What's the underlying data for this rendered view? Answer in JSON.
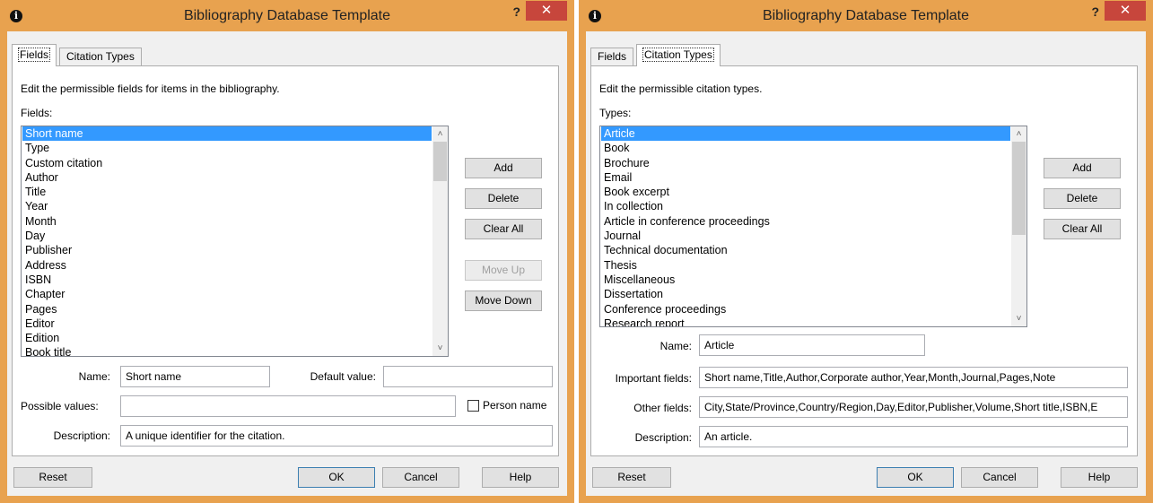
{
  "left": {
    "title": "Bibliography Database Template",
    "help_glyph": "?",
    "close_glyph": "✕",
    "tabs": [
      {
        "label": "Fields",
        "active": true
      },
      {
        "label": "Citation Types",
        "active": false
      }
    ],
    "description": "Edit the permissible fields for items in the bibliography.",
    "list_label": "Fields:",
    "list_items": [
      "Short name",
      "Type",
      "Custom citation",
      "Author",
      "Title",
      "Year",
      "Month",
      "Day",
      "Publisher",
      "Address",
      "ISBN",
      "Chapter",
      "Pages",
      "Editor",
      "Edition",
      "Book title"
    ],
    "selected_index": 0,
    "buttons": {
      "add": "Add",
      "delete": "Delete",
      "clear_all": "Clear All",
      "move_up": "Move Up",
      "move_down": "Move Down"
    },
    "name_label": "Name:",
    "name_value": "Short name",
    "default_label": "Default value:",
    "default_value": "",
    "possible_label": "Possible values:",
    "possible_value": "",
    "person_name_label": "Person name",
    "person_name_checked": false,
    "description_label": "Description:",
    "description_value": "A unique identifier for the citation.",
    "footer": {
      "reset": "Reset",
      "ok": "OK",
      "cancel": "Cancel",
      "help": "Help"
    }
  },
  "right": {
    "title": "Bibliography Database Template",
    "help_glyph": "?",
    "close_glyph": "✕",
    "tabs": [
      {
        "label": "Fields",
        "active": false
      },
      {
        "label": "Citation Types",
        "active": true
      }
    ],
    "description": "Edit the permissible citation types.",
    "list_label": "Types:",
    "list_items": [
      "Article",
      "Book",
      "Brochure",
      "Email",
      "Book excerpt",
      "In collection",
      "Article in conference proceedings",
      "Journal",
      "Technical documentation",
      "Thesis",
      "Miscellaneous",
      "Dissertation",
      "Conference proceedings",
      "Research report"
    ],
    "selected_index": 0,
    "buttons": {
      "add": "Add",
      "delete": "Delete",
      "clear_all": "Clear All"
    },
    "name_label": "Name:",
    "name_value": "Article",
    "important_label": "Important fields:",
    "important_value": "Short name,Title,Author,Corporate author,Year,Month,Journal,Pages,Note",
    "other_label": "Other fields:",
    "other_value": "City,State/Province,Country/Region,Day,Editor,Publisher,Volume,Short title,ISBN,E",
    "description_label": "Description:",
    "description_value": "An article.",
    "footer": {
      "reset": "Reset",
      "ok": "OK",
      "cancel": "Cancel",
      "help": "Help"
    }
  },
  "colors": {
    "titlebar": "#e8a24f",
    "close": "#c7463c",
    "selection": "#3399ff"
  }
}
